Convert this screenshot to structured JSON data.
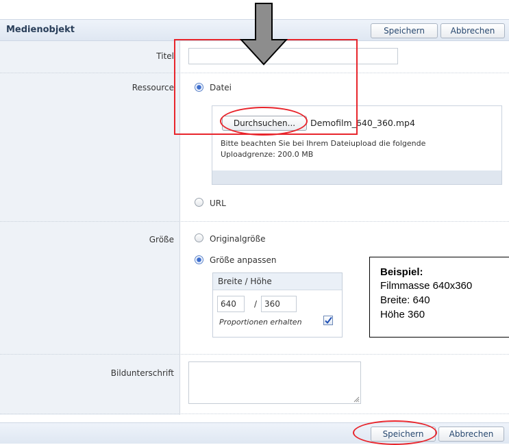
{
  "header": {
    "title": "Medienobjekt",
    "save_label": "Speichern",
    "cancel_label": "Abbrechen"
  },
  "fields": {
    "title_label": "Titel",
    "title_value": "",
    "resource_label": "Ressource",
    "resource_file_option": "Datei",
    "browse_button": "Durchsuchen...",
    "file_name": "Demofilm_640_360.mp4",
    "upload_hint_line1": "Bitte beachten Sie bei Ihrem Dateiupload die folgende",
    "upload_hint_line2": "Uploadgrenze: 200.0 MB",
    "resource_url_option": "URL",
    "size_label": "Größe",
    "size_original_option": "Originalgröße",
    "size_custom_option": "Größe anpassen",
    "dimension_header": "Breite / Höhe",
    "width_value": "640",
    "height_separator": "/",
    "height_value": "360",
    "keep_proportions_label": "Proportionen erhalten",
    "caption_label": "Bildunterschrift",
    "caption_value": ""
  },
  "state": {
    "resource_selected": "Datei",
    "size_selected": "Größe anpassen",
    "keep_proportions_checked": true
  },
  "annotation": {
    "title": "Beispiel:",
    "line1": "Filmmasse 640x360",
    "line2": "Breite: 640",
    "line3": "Höhe 360"
  },
  "footer": {
    "save_label": "Speichern",
    "cancel_label": "Abbrechen"
  },
  "colors": {
    "highlight_red": "#e8242b",
    "header_bg": "#e4ebf4",
    "accent_blue": "#3c6dcc"
  },
  "icons": {
    "arrow": "down-arrow-icon",
    "checkbox": "checkmark-icon",
    "resize": "resize-handle-icon"
  }
}
